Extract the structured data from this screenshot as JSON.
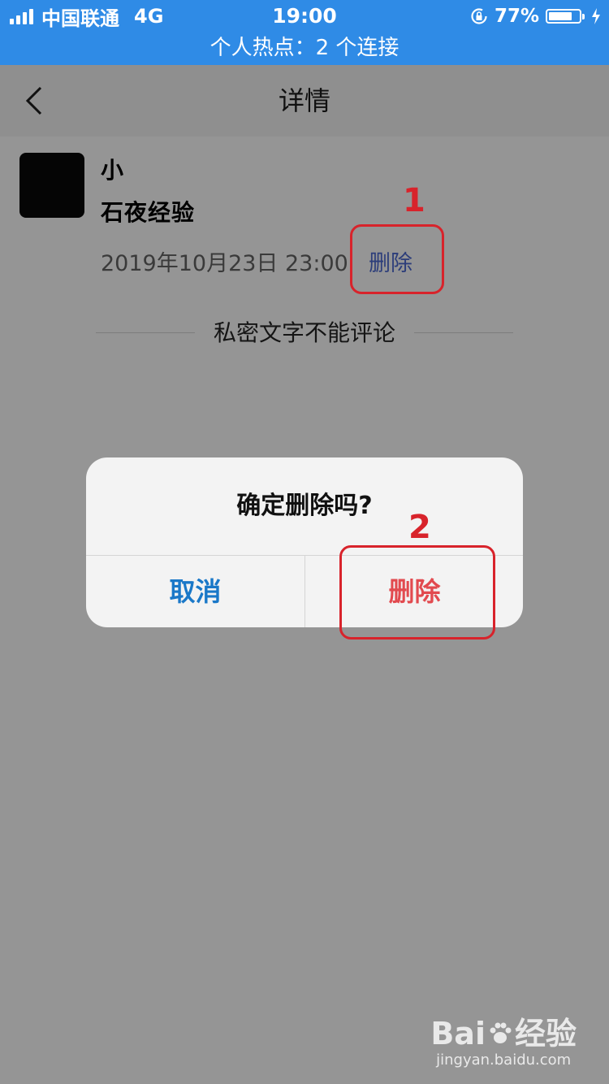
{
  "status_bar": {
    "carrier": "中国联通",
    "network": "4G",
    "time": "19:00",
    "battery_percent": "77%",
    "battery_level": 0.77,
    "hotspot_text": "个人热点：2 个连接"
  },
  "nav": {
    "title": "详情",
    "back_icon": "chevron-left-icon"
  },
  "post": {
    "username": "小",
    "text": "石夜经验",
    "date": "2019年10月23日 23:00",
    "delete_label": "删除",
    "private_notice": "私密文字不能评论"
  },
  "dialog": {
    "title": "确定删除吗?",
    "cancel_label": "取消",
    "delete_label": "删除"
  },
  "annotations": {
    "step1": "1",
    "step2": "2"
  },
  "watermark": {
    "brand_prefix": "Bai",
    "brand_suffix": "经验",
    "url": "jingyan.baidu.com"
  },
  "colors": {
    "status_bar_bg": "#2f8be6",
    "overlay_bg": "#959595",
    "cancel_blue": "#1a78c8",
    "delete_red": "#e24a4f",
    "annotation_red": "#d8232b"
  }
}
